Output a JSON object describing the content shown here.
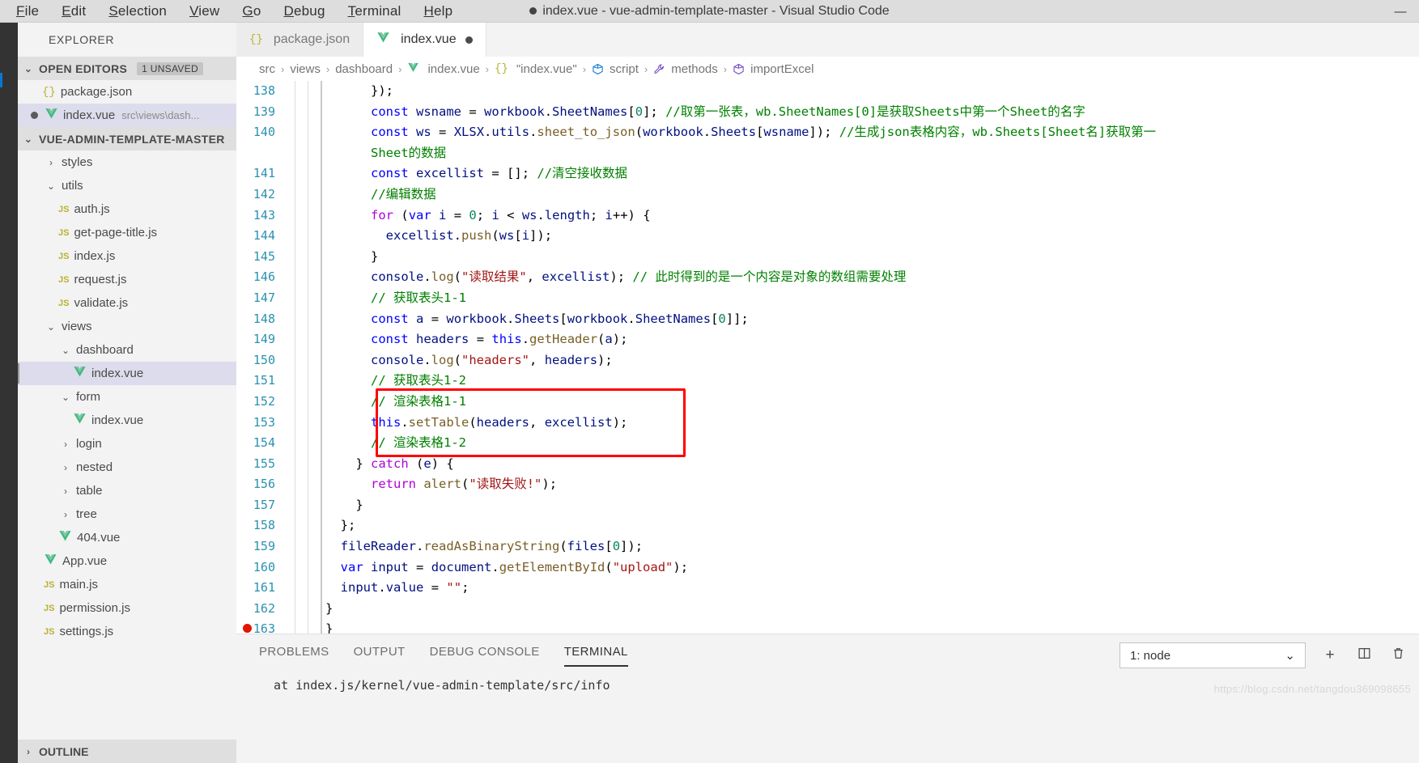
{
  "window": {
    "title": "index.vue - vue-admin-template-master - Visual Studio Code",
    "dirty_indicator": "●",
    "minimize": "—"
  },
  "menubar": [
    {
      "label": "File"
    },
    {
      "label": "Edit"
    },
    {
      "label": "Selection"
    },
    {
      "label": "View"
    },
    {
      "label": "Go"
    },
    {
      "label": "Debug"
    },
    {
      "label": "Terminal"
    },
    {
      "label": "Help"
    }
  ],
  "sidebar": {
    "title": "EXPLORER",
    "open_editors": {
      "label": "OPEN EDITORS",
      "badge": "1 UNSAVED",
      "items": [
        {
          "name": "package.json",
          "icon": "json-icon",
          "dirty": false,
          "path": ""
        },
        {
          "name": "index.vue",
          "icon": "vue-icon",
          "dirty": true,
          "path": "src\\views\\dash..."
        }
      ]
    },
    "project": {
      "label": "VUE-ADMIN-TEMPLATE-MASTER",
      "tree": [
        {
          "label": "styles",
          "kind": "folder",
          "expanded": false,
          "depth": 1
        },
        {
          "label": "utils",
          "kind": "folder",
          "expanded": true,
          "depth": 1
        },
        {
          "label": "auth.js",
          "kind": "js",
          "depth": 2
        },
        {
          "label": "get-page-title.js",
          "kind": "js",
          "depth": 2
        },
        {
          "label": "index.js",
          "kind": "js",
          "depth": 2
        },
        {
          "label": "request.js",
          "kind": "js",
          "depth": 2
        },
        {
          "label": "validate.js",
          "kind": "js",
          "depth": 2
        },
        {
          "label": "views",
          "kind": "folder",
          "expanded": true,
          "depth": 1
        },
        {
          "label": "dashboard",
          "kind": "folder",
          "expanded": true,
          "depth": 2
        },
        {
          "label": "index.vue",
          "kind": "vue",
          "depth": 3,
          "selected": true
        },
        {
          "label": "form",
          "kind": "folder",
          "expanded": true,
          "depth": 2
        },
        {
          "label": "index.vue",
          "kind": "vue",
          "depth": 3
        },
        {
          "label": "login",
          "kind": "folder",
          "expanded": false,
          "depth": 2
        },
        {
          "label": "nested",
          "kind": "folder",
          "expanded": false,
          "depth": 2
        },
        {
          "label": "table",
          "kind": "folder",
          "expanded": false,
          "depth": 2
        },
        {
          "label": "tree",
          "kind": "folder",
          "expanded": false,
          "depth": 2
        },
        {
          "label": "404.vue",
          "kind": "vue",
          "depth": 2
        },
        {
          "label": "App.vue",
          "kind": "vue",
          "depth": 1
        },
        {
          "label": "main.js",
          "kind": "js",
          "depth": 1
        },
        {
          "label": "permission.js",
          "kind": "js",
          "depth": 1
        },
        {
          "label": "settings.js",
          "kind": "js",
          "depth": 1
        }
      ]
    },
    "outline": "OUTLINE"
  },
  "tabs": [
    {
      "label": "package.json",
      "icon": "json-icon",
      "active": false,
      "dirty": false
    },
    {
      "label": "index.vue",
      "icon": "vue-icon",
      "active": true,
      "dirty": true
    }
  ],
  "breadcrumb": [
    {
      "label": "src",
      "icon": ""
    },
    {
      "label": "views",
      "icon": ""
    },
    {
      "label": "dashboard",
      "icon": ""
    },
    {
      "label": "index.vue",
      "icon": "vue-icon"
    },
    {
      "label": "\"index.vue\"",
      "icon": "json-icon"
    },
    {
      "label": "script",
      "icon": "symbol-module-icon"
    },
    {
      "label": "methods",
      "icon": "wrench-icon"
    },
    {
      "label": "importExcel",
      "icon": "symbol-method-icon"
    }
  ],
  "editor": {
    "first_line": 138,
    "lines": [
      {
        "n": 138,
        "html": "      <span class='blk'>});</span>"
      },
      {
        "n": 139,
        "html": "      <span class='kw'>const</span> <span class='var'>wsname</span> <span class='op'>=</span> <span class='var'>workbook</span><span class='op'>.</span><span class='var'>SheetNames</span><span class='blk'>[</span><span class='num'>0</span><span class='blk'>];</span> <span class='cmt'>//取第一张表，wb.SheetNames[0]是获取Sheets中第一个Sheet的名字</span>"
      },
      {
        "n": 140,
        "html": "      <span class='kw'>const</span> <span class='var'>ws</span> <span class='op'>=</span> <span class='var'>XLSX</span><span class='op'>.</span><span class='var'>utils</span><span class='op'>.</span><span class='fn'>sheet_to_json</span><span class='blk'>(</span><span class='var'>workbook</span><span class='op'>.</span><span class='var'>Sheets</span><span class='blk'>[</span><span class='var'>wsname</span><span class='blk'>]);</span> <span class='cmt'>//生成json表格内容，wb.Sheets[Sheet名]获取第一</span>",
        "wrap": "      <span class='cmt'>Sheet的数据</span>"
      },
      {
        "n": 141,
        "html": "      <span class='kw'>const</span> <span class='var'>excellist</span> <span class='op'>=</span> <span class='blk'>[];</span> <span class='cmt'>//清空接收数据</span>"
      },
      {
        "n": 142,
        "html": "      <span class='cmt'>//编辑数据</span>"
      },
      {
        "n": 143,
        "html": "      <span class='kw2'>for</span> <span class='blk'>(</span><span class='kw'>var</span> <span class='var'>i</span> <span class='op'>=</span> <span class='num'>0</span><span class='blk'>;</span> <span class='var'>i</span> <span class='op'>&lt;</span> <span class='var'>ws</span><span class='op'>.</span><span class='var'>length</span><span class='blk'>;</span> <span class='var'>i</span><span class='op'>++</span><span class='blk'>) {</span>"
      },
      {
        "n": 144,
        "html": "        <span class='var'>excellist</span><span class='op'>.</span><span class='fn'>push</span><span class='blk'>(</span><span class='var'>ws</span><span class='blk'>[</span><span class='var'>i</span><span class='blk'>]);</span>"
      },
      {
        "n": 145,
        "html": "      <span class='blk'>}</span>"
      },
      {
        "n": 146,
        "html": "      <span class='var'>console</span><span class='op'>.</span><span class='fn'>log</span><span class='blk'>(</span><span class='str'>\"读取结果\"</span><span class='blk'>,</span> <span class='var'>excellist</span><span class='blk'>);</span> <span class='cmt'>// 此时得到的是一个内容是对象的数组需要处理</span>"
      },
      {
        "n": 147,
        "html": "      <span class='cmt'>// 获取表头1-1</span>"
      },
      {
        "n": 148,
        "html": "      <span class='kw'>const</span> <span class='var'>a</span> <span class='op'>=</span> <span class='var'>workbook</span><span class='op'>.</span><span class='var'>Sheets</span><span class='blk'>[</span><span class='var'>workbook</span><span class='op'>.</span><span class='var'>SheetNames</span><span class='blk'>[</span><span class='num'>0</span><span class='blk'>]];</span>"
      },
      {
        "n": 149,
        "html": "      <span class='kw'>const</span> <span class='var'>headers</span> <span class='op'>=</span> <span class='kw'>this</span><span class='op'>.</span><span class='fn'>getHeader</span><span class='blk'>(</span><span class='var'>a</span><span class='blk'>);</span>"
      },
      {
        "n": 150,
        "html": "      <span class='var'>console</span><span class='op'>.</span><span class='fn'>log</span><span class='blk'>(</span><span class='str'>\"headers\"</span><span class='blk'>,</span> <span class='var'>headers</span><span class='blk'>);</span>"
      },
      {
        "n": 151,
        "html": "      <span class='cmt'>// 获取表头1-2</span>"
      },
      {
        "n": 152,
        "html": "      <span class='cmt'>// 渲染表格1-1</span>"
      },
      {
        "n": 153,
        "html": "      <span class='kw'>this</span><span class='op'>.</span><span class='fn'>setTable</span><span class='blk'>(</span><span class='var'>headers</span><span class='blk'>,</span> <span class='var'>excellist</span><span class='blk'>);</span>"
      },
      {
        "n": 154,
        "html": "      <span class='cmt'>// 渲染表格1-2</span>"
      },
      {
        "n": 155,
        "html": "    <span class='blk'>}</span> <span class='kw2'>catch</span> <span class='blk'>(</span><span class='var'>e</span><span class='blk'>) {</span>"
      },
      {
        "n": 156,
        "html": "      <span class='kw2'>return</span> <span class='fn'>alert</span><span class='blk'>(</span><span class='str'>\"读取失败!\"</span><span class='blk'>);</span>"
      },
      {
        "n": 157,
        "html": "    <span class='blk'>}</span>"
      },
      {
        "n": 158,
        "html": "  <span class='blk'>};</span>"
      },
      {
        "n": 159,
        "html": "  <span class='var'>fileReader</span><span class='op'>.</span><span class='fn'>readAsBinaryString</span><span class='blk'>(</span><span class='var'>files</span><span class='blk'>[</span><span class='num'>0</span><span class='blk'>]);</span>"
      },
      {
        "n": 160,
        "html": "  <span class='kw'>var</span> <span class='var'>input</span> <span class='op'>=</span> <span class='var'>document</span><span class='op'>.</span><span class='fn'>getElementById</span><span class='blk'>(</span><span class='str'>\"upload\"</span><span class='blk'>);</span>"
      },
      {
        "n": 161,
        "html": "  <span class='var'>input</span><span class='op'>.</span><span class='var'>value</span> <span class='op'>=</span> <span class='str'>\"\"</span><span class='blk'>;</span>"
      },
      {
        "n": 162,
        "html": "<span class='blk'>}</span>"
      },
      {
        "n": 163,
        "html": "<span class='blk'>}</span>",
        "breakpoint": true
      }
    ],
    "annotation": {
      "type": "red-rectangle",
      "covers_lines": [
        152,
        153,
        154
      ]
    }
  },
  "panel": {
    "tabs": [
      {
        "label": "PROBLEMS",
        "active": false
      },
      {
        "label": "OUTPUT",
        "active": false
      },
      {
        "label": "DEBUG CONSOLE",
        "active": false
      },
      {
        "label": "TERMINAL",
        "active": true
      }
    ],
    "terminal_select": "1: node",
    "chevron": "⌄",
    "actions": [
      {
        "name": "new-terminal",
        "glyph": "+"
      },
      {
        "name": "split-terminal",
        "glyph": "▯"
      },
      {
        "name": "kill-terminal",
        "glyph": "🗑"
      }
    ],
    "output": "  at index.js/kernel/vue-admin-template/src/info"
  },
  "watermark": "https://blog.csdn.net/tangdou369098655",
  "colors": {
    "accent": "#0b76d1",
    "keyword": "#0000ff",
    "control": "#af00db",
    "string": "#a31515",
    "comment": "#008000",
    "function": "#795e26",
    "variable": "#001080",
    "number": "#098658",
    "linenumber": "#2b91af",
    "annotation": "#ff0000",
    "breakpoint": "#e51400",
    "titlebar_bg": "#dddddd",
    "sidebar_bg": "#f3f3f3",
    "activitybar_bg": "#333333",
    "selection_bg": "#dcdcec"
  }
}
